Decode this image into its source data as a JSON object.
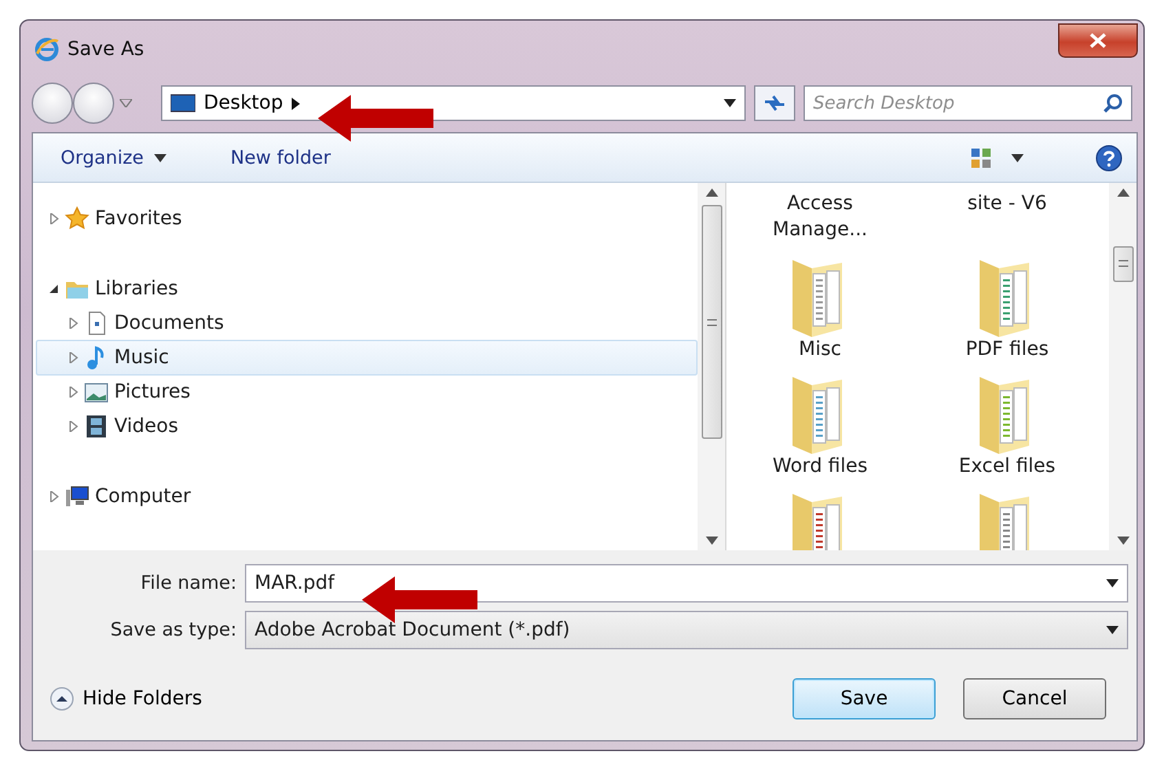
{
  "window": {
    "title": "Save As"
  },
  "address": {
    "crumbs": [
      "Desktop"
    ]
  },
  "search": {
    "placeholder": "Search Desktop"
  },
  "toolbar": {
    "organize": "Organize",
    "new_folder": "New folder"
  },
  "tree": [
    {
      "label": "Favorites",
      "kind": "star",
      "expanded": false,
      "selected": false
    },
    {
      "label": "Libraries",
      "kind": "library",
      "expanded": true,
      "selected": false,
      "children": [
        {
          "label": "Documents",
          "kind": "document",
          "expanded": false,
          "selected": false
        },
        {
          "label": "Music",
          "kind": "music",
          "expanded": false,
          "selected": true
        },
        {
          "label": "Pictures",
          "kind": "pictures",
          "expanded": false,
          "selected": false
        },
        {
          "label": "Videos",
          "kind": "videos",
          "expanded": false,
          "selected": false
        }
      ]
    },
    {
      "label": "Computer",
      "kind": "computer",
      "expanded": false,
      "selected": false
    }
  ],
  "files": [
    {
      "kind": "label",
      "name": "Access Manage..."
    },
    {
      "kind": "label",
      "name": "site - V6"
    },
    {
      "kind": "folder",
      "name": "Misc"
    },
    {
      "kind": "folder",
      "name": "PDF files"
    },
    {
      "kind": "folder",
      "name": "Word files"
    },
    {
      "kind": "folder",
      "name": "Excel files"
    },
    {
      "kind": "icon"
    },
    {
      "kind": "icon"
    }
  ],
  "file_name": {
    "label": "File name:",
    "value": "MAR.pdf"
  },
  "save_as_type": {
    "label": "Save as type:",
    "value": "Adobe Acrobat Document (*.pdf)"
  },
  "hide_folders": "Hide Folders",
  "buttons": [
    {
      "label": "Save",
      "default": true
    },
    {
      "label": "Cancel",
      "default": false
    }
  ]
}
